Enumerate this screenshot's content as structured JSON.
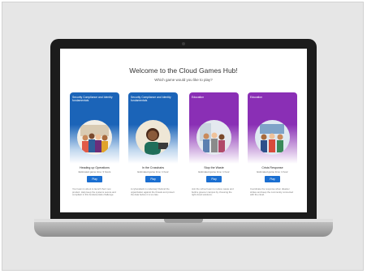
{
  "hub": {
    "title": "Welcome to the Cloud Games Hub!",
    "subtitle": "Which game would you like to play?"
  },
  "cards": [
    {
      "tag": "Security Compliance and Identity fundamentals",
      "name": "Heading up Operations",
      "meta": "Estimated game time: 3 hours",
      "play_label": "Play",
      "description": "Your team is about to launch their new product. Help keep the systems secure and compliant in this fundamentals challenge.",
      "theme": "blue"
    },
    {
      "tag": "Security Compliance and Identity fundamentals",
      "name": "In the Crosshairs",
      "meta": "Estimated game time: 1 hour",
      "play_label": "Play",
      "description": "A cyberattack is underway! Defend the organization against the threats and protect the data before it is too late.",
      "theme": "blue"
    },
    {
      "tag": "Education",
      "name": "Stop the Waste",
      "meta": "Estimated game time: 1 hour",
      "play_label": "Play",
      "description": "Join the school team to reduce waste and build a greener campus by choosing the right cloud solutions.",
      "theme": "purple"
    },
    {
      "tag": "Education",
      "name": "Crisis Response",
      "meta": "Estimated game time: 1 hour",
      "play_label": "Play",
      "description": "Coordinate the response when disaster strikes and keep the community connected with the cloud.",
      "theme": "purple"
    }
  ],
  "colors": {
    "blue": "#1b64b8",
    "purple": "#8a2fb5",
    "play_button": "#1b6fd1"
  }
}
